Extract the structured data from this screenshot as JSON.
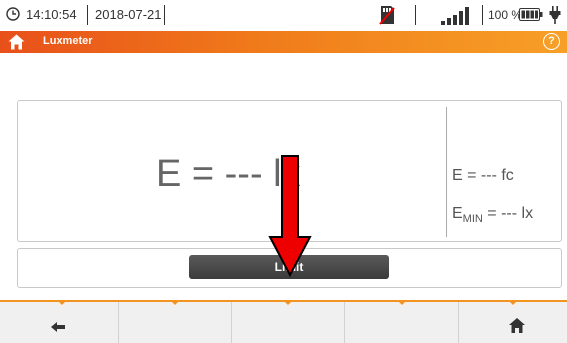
{
  "statusbar": {
    "time": "14:10:54",
    "date": "2018-07-21",
    "battery_percent": "100 %",
    "icons": [
      "clock-icon",
      "sd-card-icon",
      "signal-icon",
      "battery-icon",
      "plug-icon"
    ]
  },
  "header": {
    "title": "Luxmeter",
    "help_label": "?",
    "icons": [
      "home-icon",
      "help-icon"
    ]
  },
  "measurement": {
    "main": "E = --- lx",
    "fc": "E = --- fc",
    "emin_prefix": "E",
    "emin_sub": "MIN",
    "emin_suffix": " = --- lx"
  },
  "limit": {
    "label": "Limit"
  },
  "toolbar": {
    "icons": [
      "back-arrow-icon",
      "home-icon"
    ]
  },
  "colors": {
    "header_gradient": [
      "#e8501a",
      "#f7a027"
    ],
    "accent": "#f39322",
    "arrow": "#ee0000",
    "button": "#444444"
  }
}
